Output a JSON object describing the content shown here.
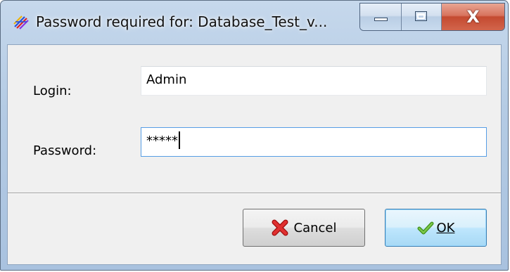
{
  "window": {
    "title": "Password required for: Database_Test_v...",
    "minimize_icon": "minimize-icon",
    "maximize_icon": "maximize-icon",
    "close_icon": "close-icon",
    "close_glyph": "X",
    "app_icon": "app-logo-icon"
  },
  "form": {
    "login_label": "Login:",
    "login_value": "Admin",
    "password_label": "Password:",
    "password_value": "*****"
  },
  "buttons": {
    "cancel_label": "Cancel",
    "cancel_icon": "red-x-icon",
    "ok_label": "OK",
    "ok_icon": "green-check-icon"
  },
  "colors": {
    "title_bar": "#b4cbe4",
    "close_button": "#c44a30",
    "ok_button_border": "#3c7fb1",
    "password_focus_border": "#569de5"
  }
}
